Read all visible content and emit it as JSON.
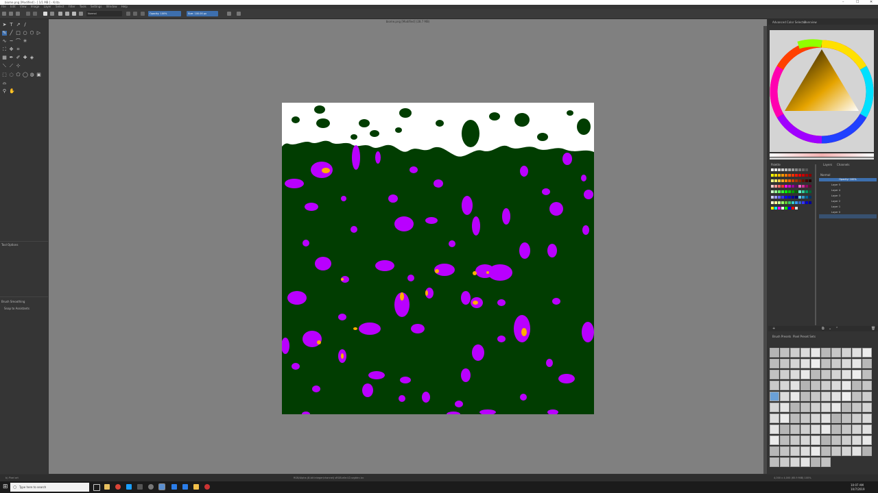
{
  "window": {
    "title": "biome.png [Modified] - [ 1/1 MB ] - Krita",
    "min": "–",
    "max": "☐",
    "close": "✕"
  },
  "menu": [
    "File",
    "Edit",
    "View",
    "Image",
    "Layer",
    "Select",
    "Filter",
    "Tools",
    "Settings",
    "Window",
    "Help"
  ],
  "toolbar": {
    "blend_mode": "Normal",
    "opacity": "Opacity: 100%",
    "size": "Size: 100.00 px"
  },
  "document": {
    "title": "biome.png [Modified] (28.7 MB)"
  },
  "toolbox_panels": {
    "tool_options": "Tool Options",
    "brush_smoothing": "Brush Smoothing",
    "snap": "Snap to Assistants"
  },
  "right_panel": {
    "tabs": [
      "Advanced Color Selector",
      "Overview"
    ],
    "palette_tab": "Palette",
    "layers_tabs": [
      "Layers",
      "Channels"
    ],
    "blending": "Normal",
    "opacity": "Opacity: 100%",
    "layers": [
      "Layer 5",
      "Layer 4",
      "Layer 3",
      "Layer 2",
      "Layer 1",
      "Layer 0"
    ],
    "presets_tabs": [
      "Brush Presets",
      "Pixel Preset Sets"
    ]
  },
  "status": {
    "left": "b) Pixel art",
    "center": "RGB/Alpha (8-bit integer/channel)  sRGB-elle-V2-srgbtrc.icc",
    "right": "4,000 x 4,000 (65.9 MiB)  100%"
  },
  "taskbar": {
    "search": "Type here to search",
    "time": "10:07 AM",
    "date": "10/7/2019"
  },
  "colors": {
    "canvas_bg": "#808080",
    "doc_green": "#013d01",
    "magenta": "#b900ff",
    "orange": "#ffae00",
    "ui_dark": "#323232"
  }
}
